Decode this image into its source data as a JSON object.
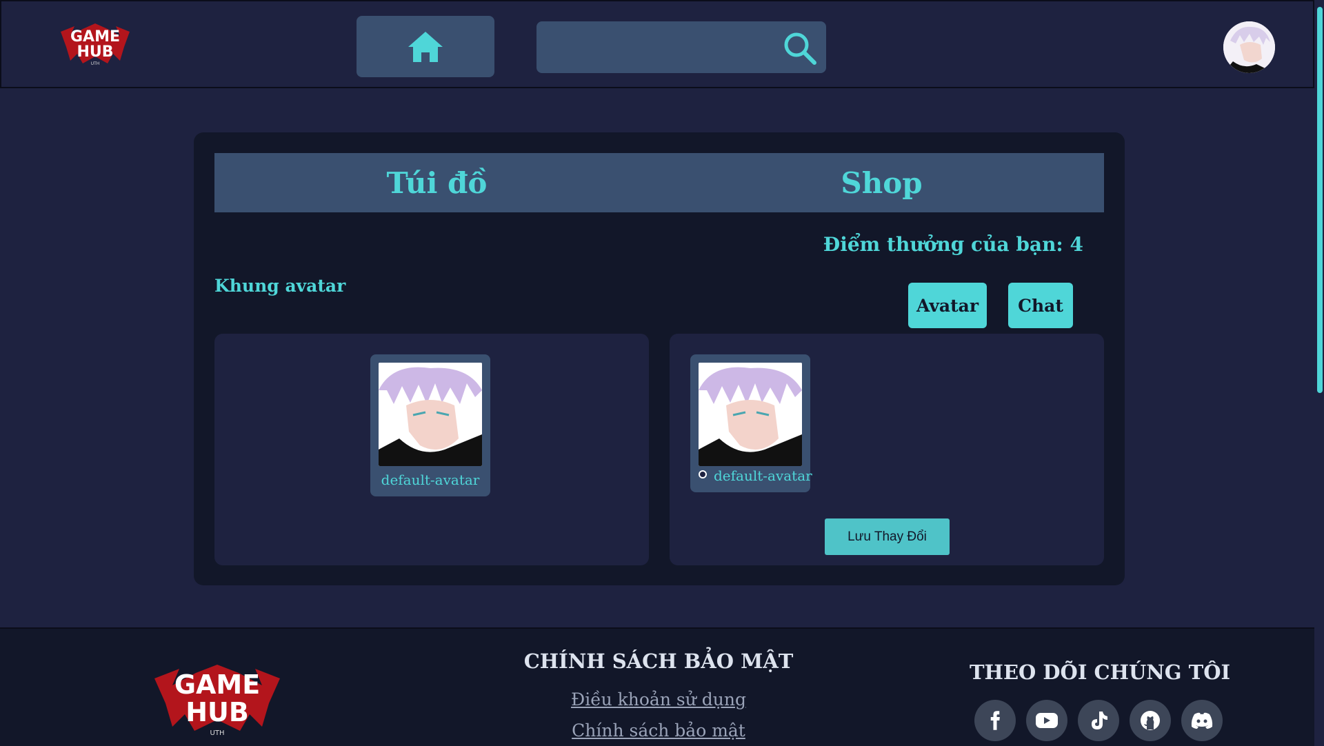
{
  "header": {
    "logo_line1": "GAME",
    "logo_line2": "HUB",
    "logo_tagline": "UTH",
    "search_placeholder": ""
  },
  "tabs": [
    {
      "label": "Túi đồ"
    },
    {
      "label": "Shop"
    }
  ],
  "points_label": "Điểm thưởng của bạn: 4",
  "section_label": "Khung avatar",
  "filters": {
    "avatar": "Avatar",
    "chat": "Chat"
  },
  "inventory_items": [
    {
      "name": "default-avatar"
    }
  ],
  "shop_items": [
    {
      "name": "default-avatar"
    }
  ],
  "save_button": "Lưu Thay Đổi",
  "footer": {
    "logo_line1": "GAME",
    "logo_line2": "HUB",
    "logo_tagline": "UTH",
    "policy_title": "CHÍNH SÁCH BẢO MẬT",
    "links": [
      "Điều khoản sử dụng",
      "Chính sách bảo mật"
    ],
    "follow_title": "THEO DÕI CHÚNG TÔI",
    "socials": [
      "facebook-icon",
      "youtube-icon",
      "tiktok-icon",
      "github-icon",
      "discord-icon"
    ]
  },
  "colors": {
    "accent": "#4fd6d8",
    "background": "#1e2240",
    "panel": "#121729",
    "tab_bar": "#3a5070"
  }
}
